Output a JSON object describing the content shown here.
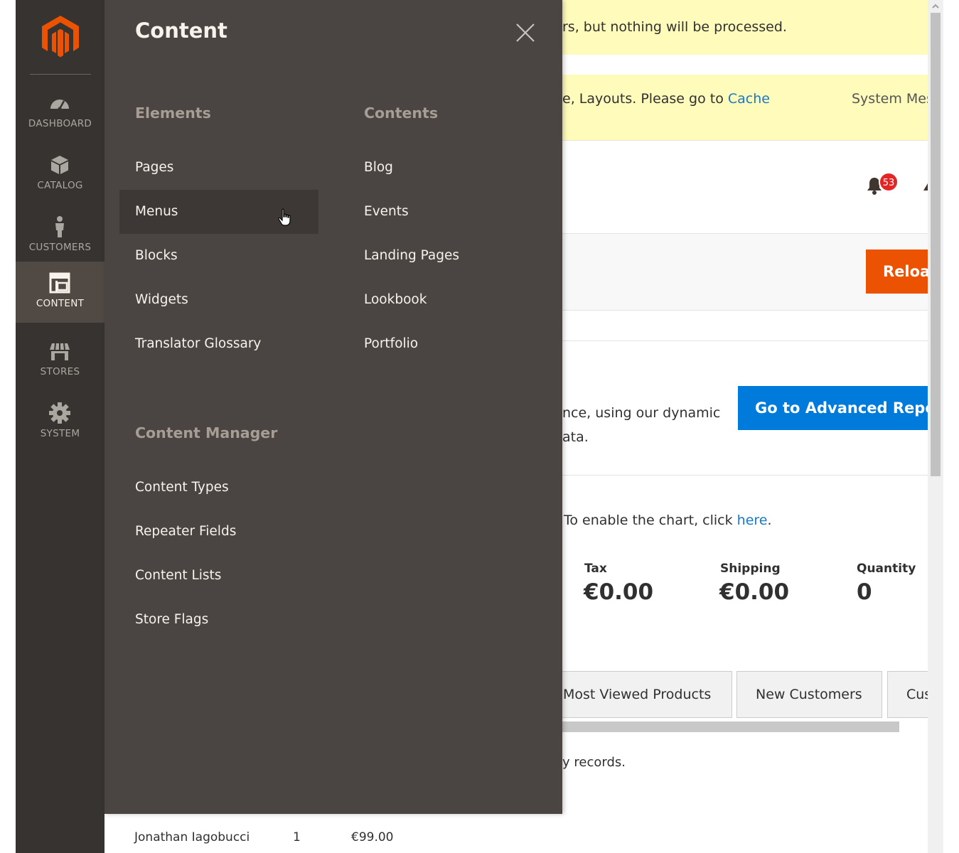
{
  "sidebar": {
    "items": [
      {
        "label": "DASHBOARD",
        "icon": "dashboard-icon",
        "active": false
      },
      {
        "label": "CATALOG",
        "icon": "catalog-icon",
        "active": false
      },
      {
        "label": "CUSTOMERS",
        "icon": "customers-icon",
        "active": false
      },
      {
        "label": "CONTENT",
        "icon": "content-icon",
        "active": true
      },
      {
        "label": "STORES",
        "icon": "stores-icon",
        "active": false
      },
      {
        "label": "SYSTEM",
        "icon": "system-icon",
        "active": false
      }
    ]
  },
  "flyout": {
    "title": "Content",
    "elements": {
      "title": "Elements",
      "items": [
        "Pages",
        "Menus",
        "Blocks",
        "Widgets",
        "Translator Glossary"
      ]
    },
    "contents": {
      "title": "Contents",
      "items": [
        "Blog",
        "Events",
        "Landing Pages",
        "Lookbook",
        "Portfolio"
      ]
    },
    "content_manager": {
      "title": "Content Manager",
      "items": [
        "Content Types",
        "Repeater Fields",
        "Content Lists",
        "Store Flags"
      ]
    }
  },
  "background": {
    "message1": "rs, but nothing will be processed.",
    "message2_prefix": "e, Layouts. Please go to ",
    "message2_link": "Cache",
    "system_messages": "System Mes",
    "notification_count": "53",
    "reload_label": "Reloa",
    "advanced_text1": "nce, using our dynamic",
    "advanced_text2": "ata.",
    "advanced_button": "Go to Advanced Repo",
    "chart_prefix": "To enable the chart, click ",
    "chart_link": "here",
    "chart_suffix": ".",
    "stats": [
      {
        "label": "Tax",
        "value": "€0.00"
      },
      {
        "label": "Shipping",
        "value": "€0.00"
      },
      {
        "label": "Quantity",
        "value": "0"
      }
    ],
    "tabs": [
      "Most Viewed Products",
      "New Customers",
      "Cus"
    ],
    "records_text": "y records.",
    "row": {
      "name": "Jonathan Iagobucci",
      "qty": "1",
      "total": "€99.00"
    }
  }
}
